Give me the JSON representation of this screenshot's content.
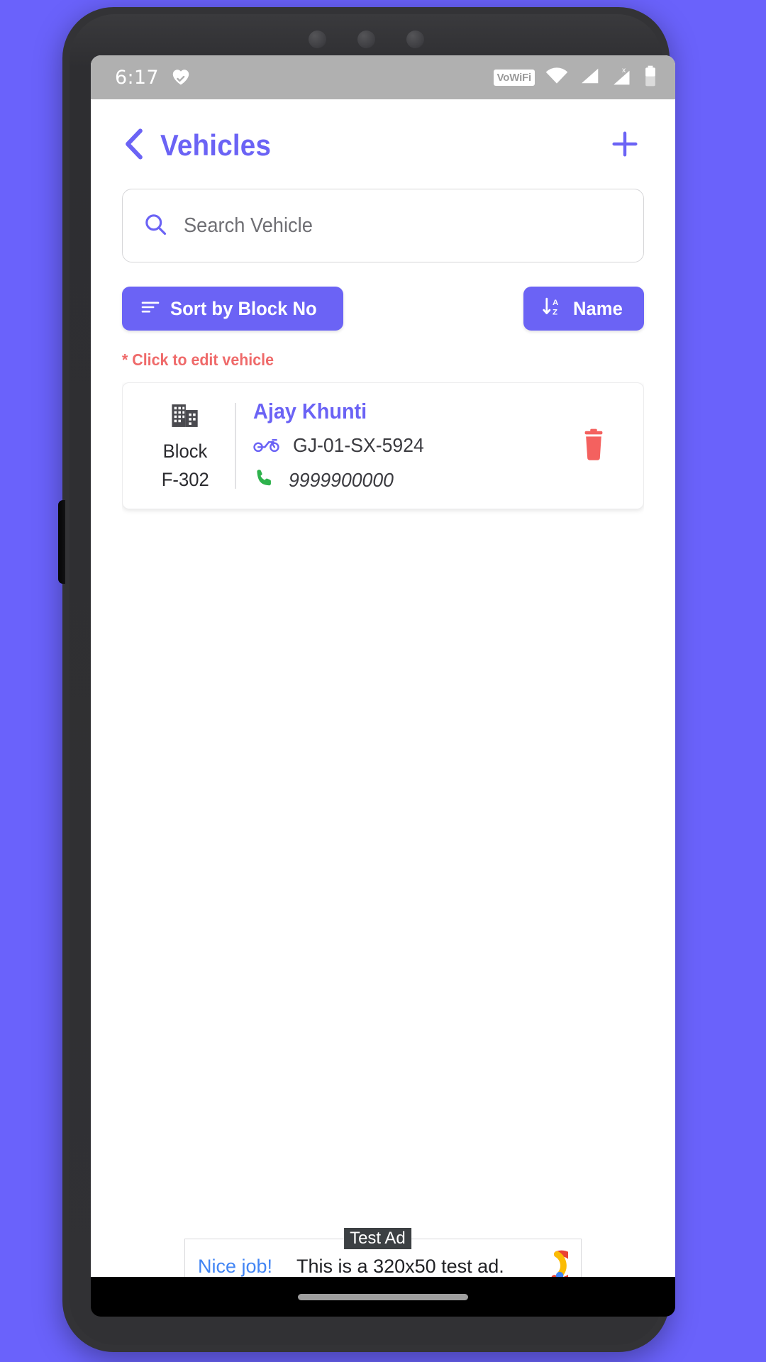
{
  "status_bar": {
    "time": "6:17",
    "heart_icon": "heart-check-icon",
    "vowifi_label": "VoWiFi",
    "wifi_icon": "wifi-icon",
    "signal_icon": "signal-bars-icon",
    "signal_x_icon": "signal-no-sim-icon",
    "battery_icon": "battery-icon"
  },
  "header": {
    "back_icon": "chevron-left-icon",
    "title": "Vehicles",
    "add_icon": "plus-icon"
  },
  "search": {
    "icon": "search-icon",
    "placeholder": "Search Vehicle",
    "value": ""
  },
  "sort": {
    "block_button": {
      "icon": "sort-lines-icon",
      "label": "Sort by Block No"
    },
    "name_button": {
      "icon": "sort-az-down-icon",
      "label": "Name"
    }
  },
  "hint": {
    "text": "* Click to edit vehicle",
    "color": "#ef6a6a"
  },
  "vehicles": [
    {
      "building_icon": "building-icon",
      "block_label": "Block",
      "block_value": "F-302",
      "owner": "Ajay Khunti",
      "vehicle_icon": "motorcycle-icon",
      "plate": "GJ-01-SX-5924",
      "phone_icon": "phone-icon",
      "phone": "9999900000",
      "delete_icon": "trash-icon"
    }
  ],
  "ad": {
    "test_label": "Test Ad",
    "cta": "Nice job!",
    "body": "This is a 320x50 test ad.",
    "logo_icon": "admob-logo-icon"
  },
  "theme": {
    "accent": "#6b63f5",
    "background": "#6a62fb",
    "danger": "#f4615f",
    "success": "#2eb24c"
  }
}
